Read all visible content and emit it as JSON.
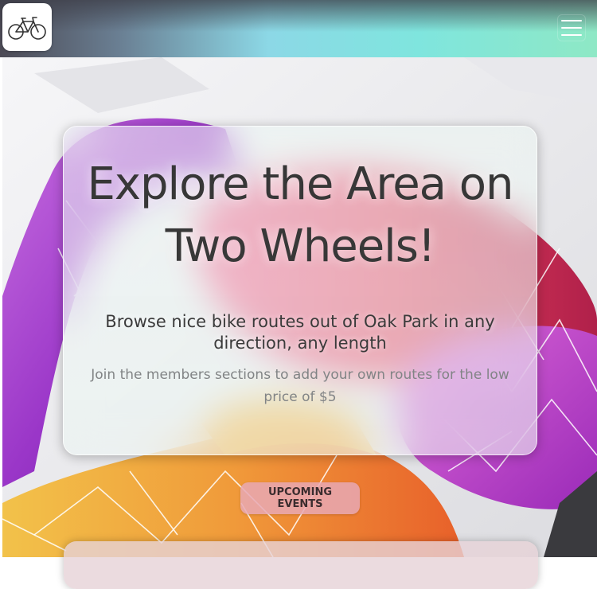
{
  "navbar": {
    "logo_icon": "bicycle-icon",
    "menu_icon": "hamburger-menu-icon"
  },
  "hero": {
    "title": "Explore the Area on Two Wheels!",
    "subtitle": "Browse nice bike routes out of Oak Park in any direction, any length",
    "note": "Join the members sections to add your own routes for the low price of $5",
    "events_button": "UPCOMING EVENTS"
  },
  "colors": {
    "accent_pink": "#e8a8b4",
    "nav_teal": "#8ce0d8",
    "text_dark": "#2b2b2b",
    "text_muted": "#777a7c"
  }
}
